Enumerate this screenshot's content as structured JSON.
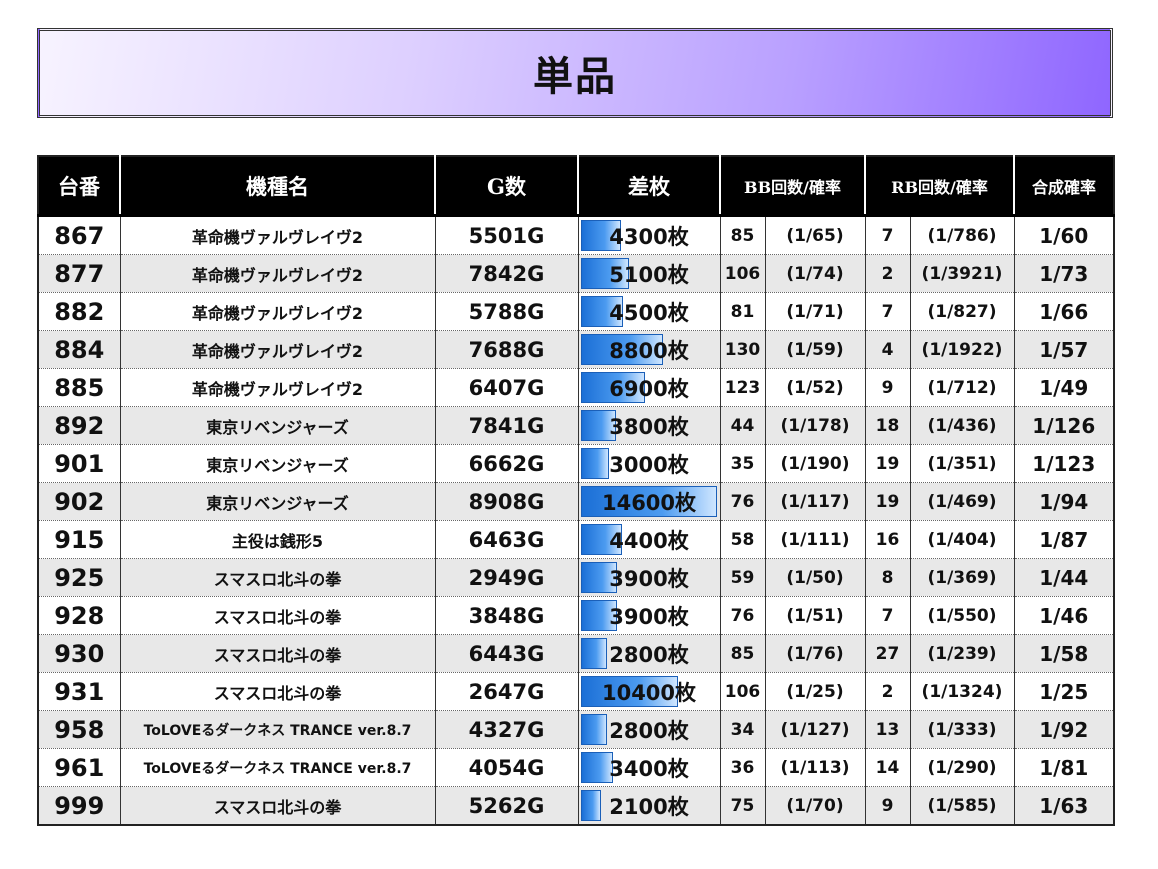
{
  "title": "単品",
  "headers": {
    "no": "台番",
    "model": "機種名",
    "games": "G数",
    "diff": "差枚",
    "bb": "BB回数/確率",
    "rb": "RB回数/確率",
    "combined": "合成確率"
  },
  "diff_max": 14600,
  "rows": [
    {
      "no": "867",
      "model": "革命機ヴァルヴレイヴ2",
      "games": "5501G",
      "diff": "4300枚",
      "diff_value": 4300,
      "bb": "85",
      "bb_rate": "(1/65)",
      "rb": "7",
      "rb_rate": "(1/786)",
      "combined": "1/60"
    },
    {
      "no": "877",
      "model": "革命機ヴァルヴレイヴ2",
      "games": "7842G",
      "diff": "5100枚",
      "diff_value": 5100,
      "bb": "106",
      "bb_rate": "(1/74)",
      "rb": "2",
      "rb_rate": "(1/3921)",
      "combined": "1/73"
    },
    {
      "no": "882",
      "model": "革命機ヴァルヴレイヴ2",
      "games": "5788G",
      "diff": "4500枚",
      "diff_value": 4500,
      "bb": "81",
      "bb_rate": "(1/71)",
      "rb": "7",
      "rb_rate": "(1/827)",
      "combined": "1/66"
    },
    {
      "no": "884",
      "model": "革命機ヴァルヴレイヴ2",
      "games": "7688G",
      "diff": "8800枚",
      "diff_value": 8800,
      "bb": "130",
      "bb_rate": "(1/59)",
      "rb": "4",
      "rb_rate": "(1/1922)",
      "combined": "1/57"
    },
    {
      "no": "885",
      "model": "革命機ヴァルヴレイヴ2",
      "games": "6407G",
      "diff": "6900枚",
      "diff_value": 6900,
      "bb": "123",
      "bb_rate": "(1/52)",
      "rb": "9",
      "rb_rate": "(1/712)",
      "combined": "1/49"
    },
    {
      "no": "892",
      "model": "東京リベンジャーズ",
      "games": "7841G",
      "diff": "3800枚",
      "diff_value": 3800,
      "bb": "44",
      "bb_rate": "(1/178)",
      "rb": "18",
      "rb_rate": "(1/436)",
      "combined": "1/126"
    },
    {
      "no": "901",
      "model": "東京リベンジャーズ",
      "games": "6662G",
      "diff": "3000枚",
      "diff_value": 3000,
      "bb": "35",
      "bb_rate": "(1/190)",
      "rb": "19",
      "rb_rate": "(1/351)",
      "combined": "1/123"
    },
    {
      "no": "902",
      "model": "東京リベンジャーズ",
      "games": "8908G",
      "diff": "14600枚",
      "diff_value": 14600,
      "bb": "76",
      "bb_rate": "(1/117)",
      "rb": "19",
      "rb_rate": "(1/469)",
      "combined": "1/94"
    },
    {
      "no": "915",
      "model": "主役は銭形5",
      "games": "6463G",
      "diff": "4400枚",
      "diff_value": 4400,
      "bb": "58",
      "bb_rate": "(1/111)",
      "rb": "16",
      "rb_rate": "(1/404)",
      "combined": "1/87"
    },
    {
      "no": "925",
      "model": "スマスロ北斗の拳",
      "games": "2949G",
      "diff": "3900枚",
      "diff_value": 3900,
      "bb": "59",
      "bb_rate": "(1/50)",
      "rb": "8",
      "rb_rate": "(1/369)",
      "combined": "1/44"
    },
    {
      "no": "928",
      "model": "スマスロ北斗の拳",
      "games": "3848G",
      "diff": "3900枚",
      "diff_value": 3900,
      "bb": "76",
      "bb_rate": "(1/51)",
      "rb": "7",
      "rb_rate": "(1/550)",
      "combined": "1/46"
    },
    {
      "no": "930",
      "model": "スマスロ北斗の拳",
      "games": "6443G",
      "diff": "2800枚",
      "diff_value": 2800,
      "bb": "85",
      "bb_rate": "(1/76)",
      "rb": "27",
      "rb_rate": "(1/239)",
      "combined": "1/58"
    },
    {
      "no": "931",
      "model": "スマスロ北斗の拳",
      "games": "2647G",
      "diff": "10400枚",
      "diff_value": 10400,
      "bb": "106",
      "bb_rate": "(1/25)",
      "rb": "2",
      "rb_rate": "(1/1324)",
      "combined": "1/25"
    },
    {
      "no": "958",
      "model": "ToLOVEるダークネス TRANCE ver.8.7",
      "games": "4327G",
      "diff": "2800枚",
      "diff_value": 2800,
      "bb": "34",
      "bb_rate": "(1/127)",
      "rb": "13",
      "rb_rate": "(1/333)",
      "combined": "1/92"
    },
    {
      "no": "961",
      "model": "ToLOVEるダークネス TRANCE ver.8.7",
      "games": "4054G",
      "diff": "3400枚",
      "diff_value": 3400,
      "bb": "36",
      "bb_rate": "(1/113)",
      "rb": "14",
      "rb_rate": "(1/290)",
      "combined": "1/81"
    },
    {
      "no": "999",
      "model": "スマスロ北斗の拳",
      "games": "5262G",
      "diff": "2100枚",
      "diff_value": 2100,
      "bb": "75",
      "bb_rate": "(1/70)",
      "rb": "9",
      "rb_rate": "(1/585)",
      "combined": "1/63"
    }
  ]
}
